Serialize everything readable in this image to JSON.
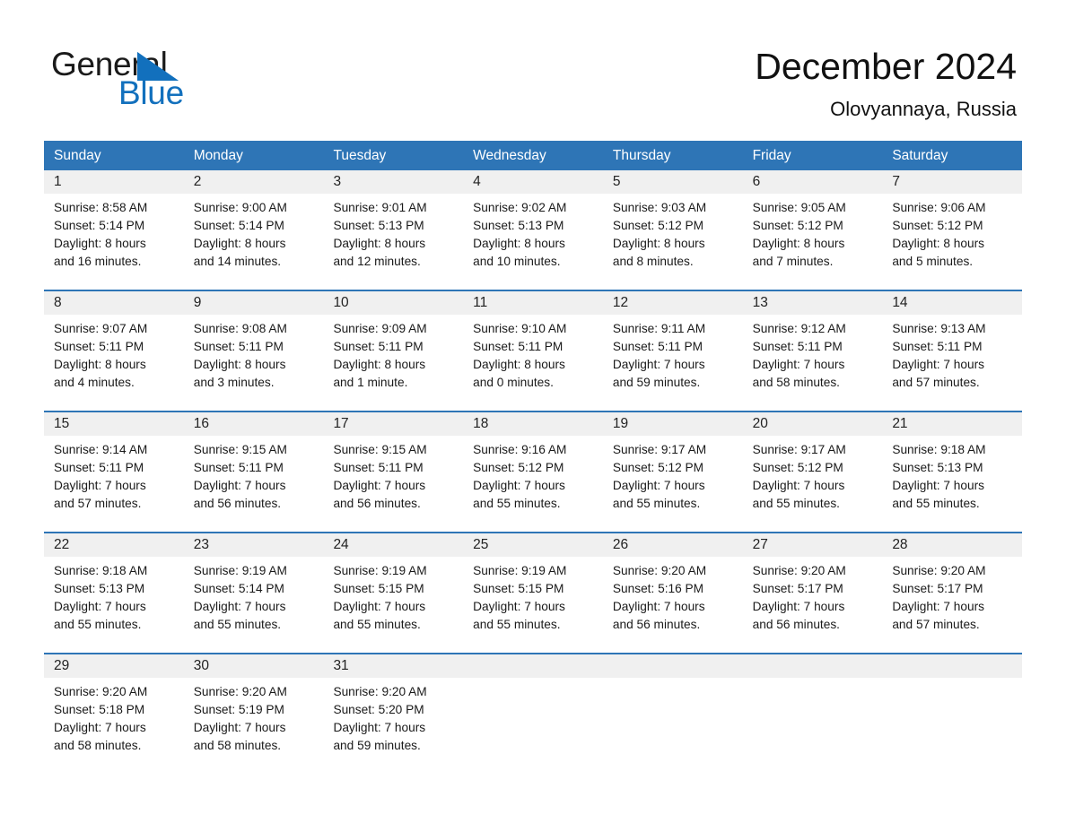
{
  "logo": {
    "word_one": "General",
    "word_two": "Blue",
    "triangle_icon": "blue-triangle-icon",
    "brand_blue": "#1270bd"
  },
  "header": {
    "title": "December 2024",
    "subtitle": "Olovyannaya, Russia"
  },
  "colors": {
    "header_blue": "#2e75b6",
    "row_rule_blue": "#2e75b6",
    "daynum_band": "#f0f0f0",
    "text": "#1a1a1a"
  },
  "weekday_headers": [
    "Sunday",
    "Monday",
    "Tuesday",
    "Wednesday",
    "Thursday",
    "Friday",
    "Saturday"
  ],
  "weeks": [
    {
      "days": [
        {
          "day": "1",
          "sunrise": "Sunrise: 8:58 AM",
          "sunset": "Sunset: 5:14 PM",
          "daylight_line1": "Daylight: 8 hours",
          "daylight_line2": "and 16 minutes."
        },
        {
          "day": "2",
          "sunrise": "Sunrise: 9:00 AM",
          "sunset": "Sunset: 5:14 PM",
          "daylight_line1": "Daylight: 8 hours",
          "daylight_line2": "and 14 minutes."
        },
        {
          "day": "3",
          "sunrise": "Sunrise: 9:01 AM",
          "sunset": "Sunset: 5:13 PM",
          "daylight_line1": "Daylight: 8 hours",
          "daylight_line2": "and 12 minutes."
        },
        {
          "day": "4",
          "sunrise": "Sunrise: 9:02 AM",
          "sunset": "Sunset: 5:13 PM",
          "daylight_line1": "Daylight: 8 hours",
          "daylight_line2": "and 10 minutes."
        },
        {
          "day": "5",
          "sunrise": "Sunrise: 9:03 AM",
          "sunset": "Sunset: 5:12 PM",
          "daylight_line1": "Daylight: 8 hours",
          "daylight_line2": "and 8 minutes."
        },
        {
          "day": "6",
          "sunrise": "Sunrise: 9:05 AM",
          "sunset": "Sunset: 5:12 PM",
          "daylight_line1": "Daylight: 8 hours",
          "daylight_line2": "and 7 minutes."
        },
        {
          "day": "7",
          "sunrise": "Sunrise: 9:06 AM",
          "sunset": "Sunset: 5:12 PM",
          "daylight_line1": "Daylight: 8 hours",
          "daylight_line2": "and 5 minutes."
        }
      ]
    },
    {
      "days": [
        {
          "day": "8",
          "sunrise": "Sunrise: 9:07 AM",
          "sunset": "Sunset: 5:11 PM",
          "daylight_line1": "Daylight: 8 hours",
          "daylight_line2": "and 4 minutes."
        },
        {
          "day": "9",
          "sunrise": "Sunrise: 9:08 AM",
          "sunset": "Sunset: 5:11 PM",
          "daylight_line1": "Daylight: 8 hours",
          "daylight_line2": "and 3 minutes."
        },
        {
          "day": "10",
          "sunrise": "Sunrise: 9:09 AM",
          "sunset": "Sunset: 5:11 PM",
          "daylight_line1": "Daylight: 8 hours",
          "daylight_line2": "and 1 minute."
        },
        {
          "day": "11",
          "sunrise": "Sunrise: 9:10 AM",
          "sunset": "Sunset: 5:11 PM",
          "daylight_line1": "Daylight: 8 hours",
          "daylight_line2": "and 0 minutes."
        },
        {
          "day": "12",
          "sunrise": "Sunrise: 9:11 AM",
          "sunset": "Sunset: 5:11 PM",
          "daylight_line1": "Daylight: 7 hours",
          "daylight_line2": "and 59 minutes."
        },
        {
          "day": "13",
          "sunrise": "Sunrise: 9:12 AM",
          "sunset": "Sunset: 5:11 PM",
          "daylight_line1": "Daylight: 7 hours",
          "daylight_line2": "and 58 minutes."
        },
        {
          "day": "14",
          "sunrise": "Sunrise: 9:13 AM",
          "sunset": "Sunset: 5:11 PM",
          "daylight_line1": "Daylight: 7 hours",
          "daylight_line2": "and 57 minutes."
        }
      ]
    },
    {
      "days": [
        {
          "day": "15",
          "sunrise": "Sunrise: 9:14 AM",
          "sunset": "Sunset: 5:11 PM",
          "daylight_line1": "Daylight: 7 hours",
          "daylight_line2": "and 57 minutes."
        },
        {
          "day": "16",
          "sunrise": "Sunrise: 9:15 AM",
          "sunset": "Sunset: 5:11 PM",
          "daylight_line1": "Daylight: 7 hours",
          "daylight_line2": "and 56 minutes."
        },
        {
          "day": "17",
          "sunrise": "Sunrise: 9:15 AM",
          "sunset": "Sunset: 5:11 PM",
          "daylight_line1": "Daylight: 7 hours",
          "daylight_line2": "and 56 minutes."
        },
        {
          "day": "18",
          "sunrise": "Sunrise: 9:16 AM",
          "sunset": "Sunset: 5:12 PM",
          "daylight_line1": "Daylight: 7 hours",
          "daylight_line2": "and 55 minutes."
        },
        {
          "day": "19",
          "sunrise": "Sunrise: 9:17 AM",
          "sunset": "Sunset: 5:12 PM",
          "daylight_line1": "Daylight: 7 hours",
          "daylight_line2": "and 55 minutes."
        },
        {
          "day": "20",
          "sunrise": "Sunrise: 9:17 AM",
          "sunset": "Sunset: 5:12 PM",
          "daylight_line1": "Daylight: 7 hours",
          "daylight_line2": "and 55 minutes."
        },
        {
          "day": "21",
          "sunrise": "Sunrise: 9:18 AM",
          "sunset": "Sunset: 5:13 PM",
          "daylight_line1": "Daylight: 7 hours",
          "daylight_line2": "and 55 minutes."
        }
      ]
    },
    {
      "days": [
        {
          "day": "22",
          "sunrise": "Sunrise: 9:18 AM",
          "sunset": "Sunset: 5:13 PM",
          "daylight_line1": "Daylight: 7 hours",
          "daylight_line2": "and 55 minutes."
        },
        {
          "day": "23",
          "sunrise": "Sunrise: 9:19 AM",
          "sunset": "Sunset: 5:14 PM",
          "daylight_line1": "Daylight: 7 hours",
          "daylight_line2": "and 55 minutes."
        },
        {
          "day": "24",
          "sunrise": "Sunrise: 9:19 AM",
          "sunset": "Sunset: 5:15 PM",
          "daylight_line1": "Daylight: 7 hours",
          "daylight_line2": "and 55 minutes."
        },
        {
          "day": "25",
          "sunrise": "Sunrise: 9:19 AM",
          "sunset": "Sunset: 5:15 PM",
          "daylight_line1": "Daylight: 7 hours",
          "daylight_line2": "and 55 minutes."
        },
        {
          "day": "26",
          "sunrise": "Sunrise: 9:20 AM",
          "sunset": "Sunset: 5:16 PM",
          "daylight_line1": "Daylight: 7 hours",
          "daylight_line2": "and 56 minutes."
        },
        {
          "day": "27",
          "sunrise": "Sunrise: 9:20 AM",
          "sunset": "Sunset: 5:17 PM",
          "daylight_line1": "Daylight: 7 hours",
          "daylight_line2": "and 56 minutes."
        },
        {
          "day": "28",
          "sunrise": "Sunrise: 9:20 AM",
          "sunset": "Sunset: 5:17 PM",
          "daylight_line1": "Daylight: 7 hours",
          "daylight_line2": "and 57 minutes."
        }
      ]
    },
    {
      "days": [
        {
          "day": "29",
          "sunrise": "Sunrise: 9:20 AM",
          "sunset": "Sunset: 5:18 PM",
          "daylight_line1": "Daylight: 7 hours",
          "daylight_line2": "and 58 minutes."
        },
        {
          "day": "30",
          "sunrise": "Sunrise: 9:20 AM",
          "sunset": "Sunset: 5:19 PM",
          "daylight_line1": "Daylight: 7 hours",
          "daylight_line2": "and 58 minutes."
        },
        {
          "day": "31",
          "sunrise": "Sunrise: 9:20 AM",
          "sunset": "Sunset: 5:20 PM",
          "daylight_line1": "Daylight: 7 hours",
          "daylight_line2": "and 59 minutes."
        },
        {
          "day": "",
          "sunrise": "",
          "sunset": "",
          "daylight_line1": "",
          "daylight_line2": ""
        },
        {
          "day": "",
          "sunrise": "",
          "sunset": "",
          "daylight_line1": "",
          "daylight_line2": ""
        },
        {
          "day": "",
          "sunrise": "",
          "sunset": "",
          "daylight_line1": "",
          "daylight_line2": ""
        },
        {
          "day": "",
          "sunrise": "",
          "sunset": "",
          "daylight_line1": "",
          "daylight_line2": ""
        }
      ]
    }
  ]
}
